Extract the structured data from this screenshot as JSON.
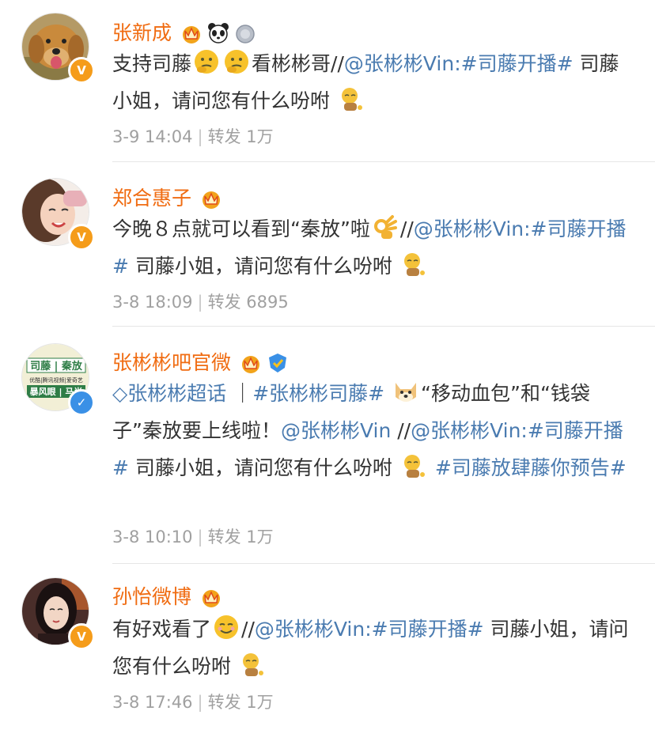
{
  "posts": [
    {
      "username": "张新成",
      "avatar": "golden-retriever-avatar",
      "verified_color": "#f59c1a",
      "badges": [
        "crown-icon",
        "panda-icon",
        "medal-icon"
      ],
      "segments": [
        {
          "t": "text",
          "v": "支持司藤"
        },
        {
          "t": "emoji",
          "v": "thinking-emoji"
        },
        {
          "t": "emoji",
          "v": "thinking-emoji"
        },
        {
          "t": "text",
          "v": "看彬彬哥//"
        },
        {
          "t": "link",
          "v": "@张彬彬Vin:"
        },
        {
          "t": "link",
          "v": "#司藤开播#"
        },
        {
          "t": "text",
          "v": " 司藤小姐，请问您有什么吩咐 "
        },
        {
          "t": "emoji",
          "v": "bow-emoji"
        }
      ],
      "date": "3-9 14:04",
      "repost_label": "转发",
      "repost_count": "1万"
    },
    {
      "username": "郑合惠子",
      "avatar": "woman-smiling-avatar",
      "verified_color": "#f59c1a",
      "badges": [
        "crown-icon"
      ],
      "segments": [
        {
          "t": "text",
          "v": "今晚８点就可以看到“秦放”啦"
        },
        {
          "t": "emoji",
          "v": "ok-hand-emoji"
        },
        {
          "t": "text",
          "v": "//"
        },
        {
          "t": "link",
          "v": "@张彬彬Vin:#司藤开播#"
        },
        {
          "t": "text",
          "v": " 司藤小姐，请问您有什么吩咐 "
        },
        {
          "t": "emoji",
          "v": "bow-emoji"
        }
      ],
      "date": "3-8 18:09",
      "repost_label": "转发",
      "repost_count": "6895"
    },
    {
      "username": "张彬彬吧官微",
      "avatar": "fanclub-logo-avatar",
      "avatar_text": [
        "司藤 | 秦放",
        "优酷|腾讯视频|爱奇艺",
        "暴风眼 | 马尚"
      ],
      "verified_color": "#3a90e6",
      "badges": [
        "crown-icon",
        "shield-icon"
      ],
      "segments": [
        {
          "t": "link",
          "v": "◇张彬彬超话"
        },
        {
          "t": "text",
          "v": " ｜"
        },
        {
          "t": "link",
          "v": "#张彬彬司藤#"
        },
        {
          "t": "text",
          "v": " "
        },
        {
          "t": "emoji",
          "v": "doge-emoji"
        },
        {
          "t": "text",
          "v": "“移动血包”和“钱袋子”秦放要上线啦！"
        },
        {
          "t": "link",
          "v": "@张彬彬Vin"
        },
        {
          "t": "text",
          "v": " //"
        },
        {
          "t": "link",
          "v": "@张彬彬Vin:#司藤开播#"
        },
        {
          "t": "text",
          "v": " 司藤小姐，请问您有什么吩咐 "
        },
        {
          "t": "emoji",
          "v": "bow-emoji"
        },
        {
          "t": "text",
          "v": " "
        },
        {
          "t": "link",
          "v": "#司藤放肆藤你预告#"
        }
      ],
      "date": "3-8 10:10",
      "repost_label": "转发",
      "repost_count": "1万"
    },
    {
      "username": "孙怡微博",
      "avatar": "woman-portrait-avatar",
      "verified_color": "#f59c1a",
      "badges": [
        "crown-icon"
      ],
      "segments": [
        {
          "t": "text",
          "v": "有好戏看了"
        },
        {
          "t": "emoji",
          "v": "smirk-emoji"
        },
        {
          "t": "text",
          "v": "//"
        },
        {
          "t": "link",
          "v": "@张彬彬Vin:#司藤开播#"
        },
        {
          "t": "text",
          "v": " 司藤小姐，请问您有什么吩咐 "
        },
        {
          "t": "emoji",
          "v": "bow-emoji"
        }
      ],
      "date": "3-8 17:46",
      "repost_label": "转发",
      "repost_count": "1万"
    }
  ]
}
